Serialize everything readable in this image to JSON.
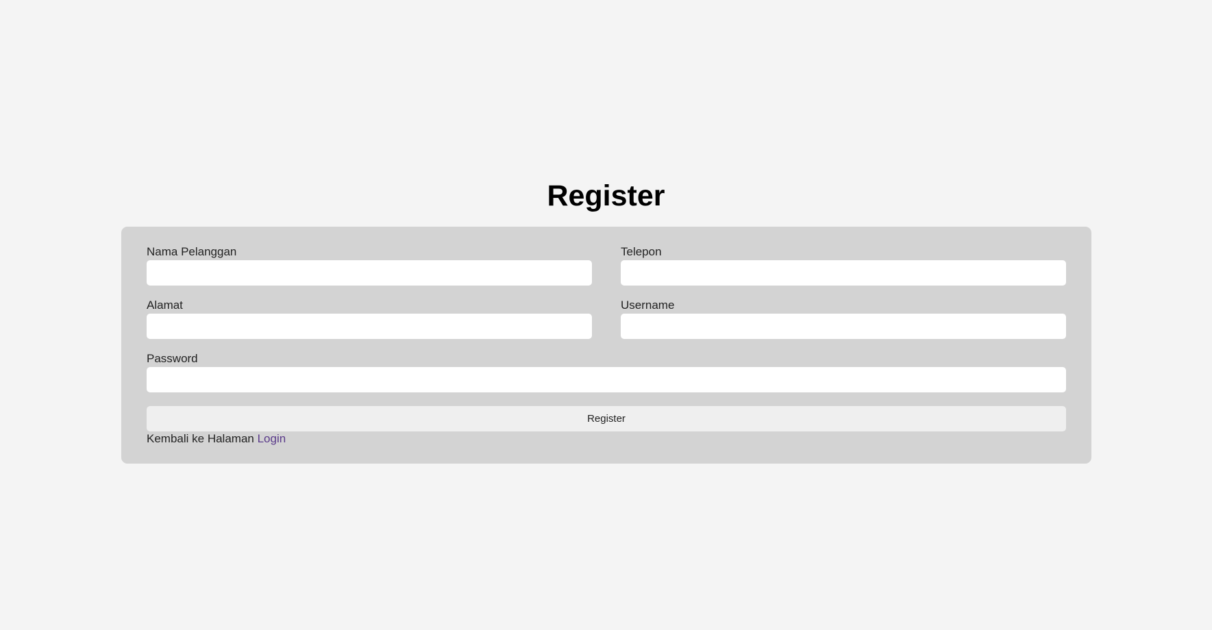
{
  "page": {
    "title": "Register"
  },
  "form": {
    "fields": {
      "nama": {
        "label": "Nama Pelanggan",
        "value": "",
        "placeholder": ""
      },
      "telepon": {
        "label": "Telepon",
        "value": "",
        "placeholder": ""
      },
      "alamat": {
        "label": "Alamat",
        "value": "",
        "placeholder": ""
      },
      "username": {
        "label": "Username",
        "value": "",
        "placeholder": ""
      },
      "password": {
        "label": "Password",
        "value": "",
        "placeholder": ""
      }
    },
    "submit_label": "Register",
    "back_text": "Kembali ke Halaman ",
    "login_link": "Login"
  },
  "colors": {
    "background": "#f4f4f4",
    "card": "#d3d3d3",
    "input": "#ffffff",
    "button": "#efefef",
    "link": "#5a3a8a"
  }
}
